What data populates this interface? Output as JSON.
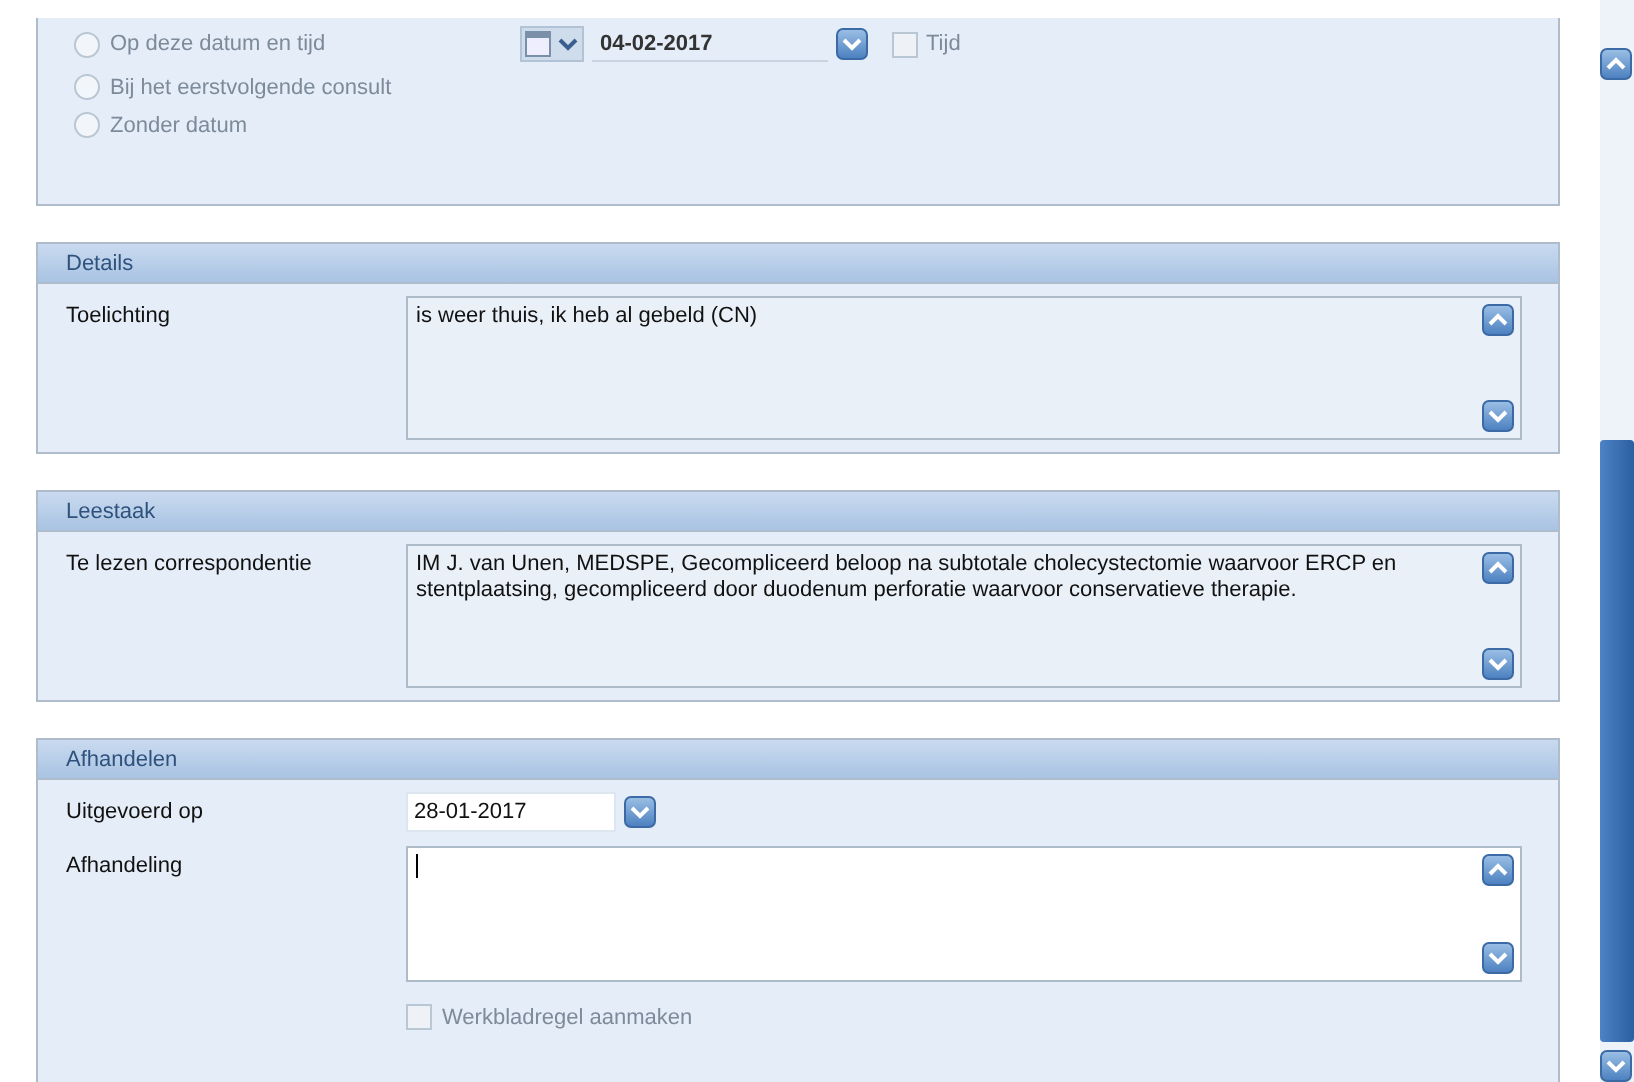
{
  "schedule": {
    "options": [
      {
        "label": "Op deze datum en tijd",
        "selected": false,
        "disabled": true
      },
      {
        "label": "Bij het eerstvolgende consult",
        "selected": false,
        "disabled": true
      },
      {
        "label": "Zonder datum",
        "selected": false,
        "disabled": true
      }
    ],
    "date": {
      "value": "04-02-2017"
    },
    "time": {
      "label": "Tijd",
      "checked": false,
      "disabled": true
    }
  },
  "sections": [
    {
      "title": "Details",
      "fields": [
        {
          "kind": "memo",
          "label": "Toelichting",
          "value": "is weer thuis, ik heb al gebeld (CN)",
          "editable": false
        }
      ]
    },
    {
      "title": "Leestaak",
      "fields": [
        {
          "kind": "memo",
          "label": "Te lezen correspondentie",
          "value": "IM J. van Unen, MEDSPE, Gecompliceerd beloop na subtotale cholecystectomie waarvoor ERCP en stentplaatsing, gecompliceerd door duodenum perforatie waarvoor conservatieve therapie.",
          "editable": false
        }
      ]
    },
    {
      "title": "Afhandelen",
      "fields": [
        {
          "kind": "date",
          "label": "Uitgevoerd op",
          "value": "28-01-2017"
        },
        {
          "kind": "memo",
          "label": "Afhandeling",
          "editable": true
        },
        {
          "kind": "checkbox",
          "label": "Werkbladregel aanmaken",
          "checked": false,
          "disabled": true
        }
      ]
    }
  ]
}
